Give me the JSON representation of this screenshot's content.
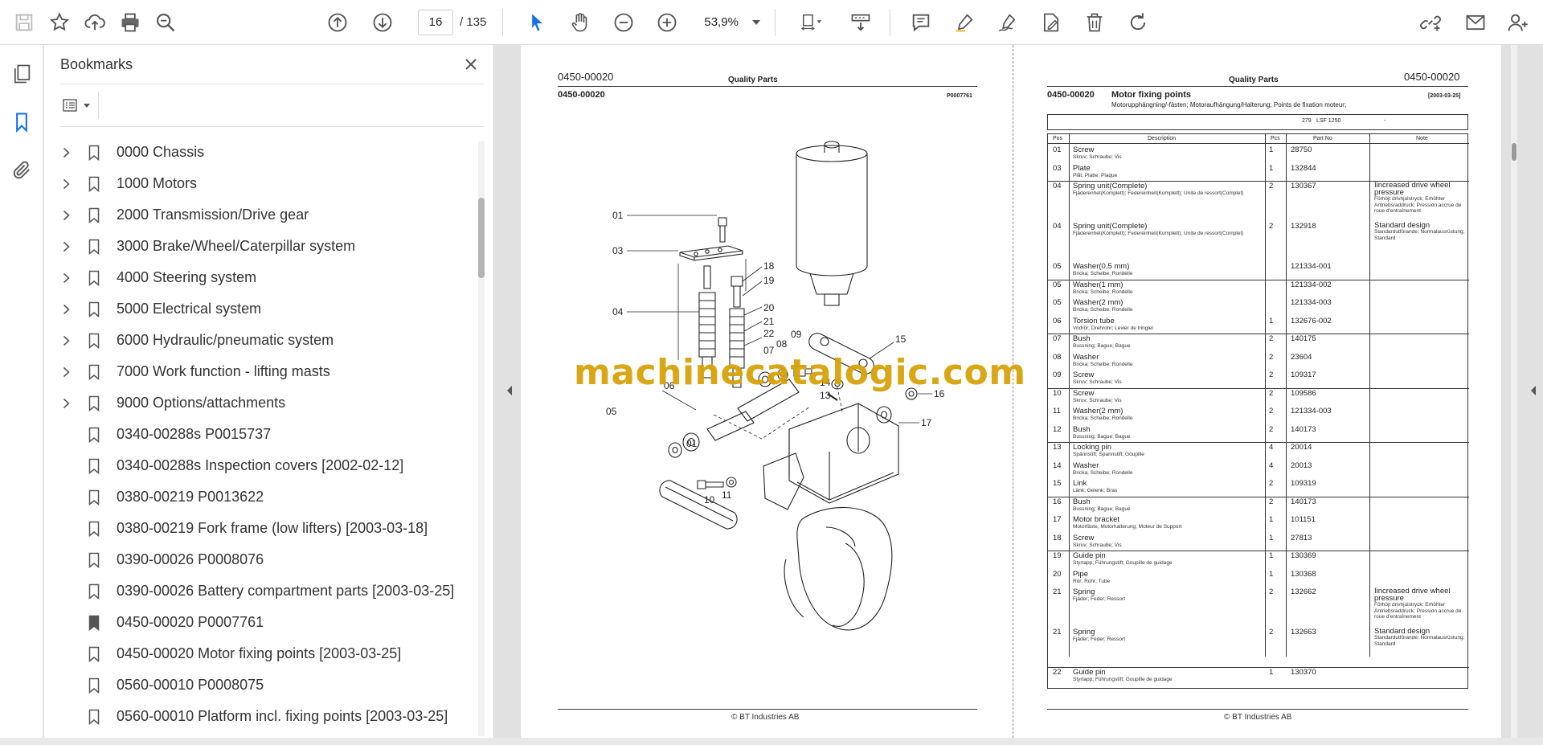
{
  "toolbar": {
    "current_page": "16",
    "page_total": "/ 135",
    "zoom": "53,9%"
  },
  "bookmarks": {
    "title": "Bookmarks",
    "items": [
      {
        "label": "0000 Chassis",
        "expandable": true
      },
      {
        "label": "1000 Motors",
        "expandable": true
      },
      {
        "label": "2000 Transmission/Drive gear",
        "expandable": true
      },
      {
        "label": "3000 Brake/Wheel/Caterpillar system",
        "expandable": true
      },
      {
        "label": "4000 Steering system",
        "expandable": true
      },
      {
        "label": "5000 Electrical system",
        "expandable": true
      },
      {
        "label": "6000 Hydraulic/pneumatic system",
        "expandable": true
      },
      {
        "label": "7000 Work function - lifting masts",
        "expandable": true
      },
      {
        "label": "9000 Options/attachments",
        "expandable": true
      },
      {
        "label": "0340-00288s P0015737",
        "expandable": false
      },
      {
        "label": "0340-00288s Inspection covers [2002-02-12]",
        "expandable": false
      },
      {
        "label": "0380-00219 P0013622",
        "expandable": false
      },
      {
        "label": "0380-00219 Fork frame (low lifters) [2003-03-18]",
        "expandable": false
      },
      {
        "label": "0390-00026 P0008076",
        "expandable": false
      },
      {
        "label": "0390-00026 Battery compartment parts [2003-03-25]",
        "expandable": false
      },
      {
        "label": "0450-00020 P0007761",
        "expandable": false,
        "active": true
      },
      {
        "label": "0450-00020 Motor fixing points [2003-03-25]",
        "expandable": false
      },
      {
        "label": "0560-00010 P0008075",
        "expandable": false
      },
      {
        "label": "0560-00010 Platform incl. fixing points [2003-03-25]",
        "expandable": false
      }
    ]
  },
  "left_page": {
    "code_top": "0450-00020",
    "header_center": "Quality Parts",
    "code_sub": "0450-00020",
    "ref": "P0007761",
    "footer": "© BT Industries AB",
    "callouts": [
      "01",
      "03",
      "04",
      "18",
      "19",
      "20",
      "21",
      "22",
      "07",
      "08",
      "09",
      "15",
      "06",
      "14",
      "13",
      "16",
      "05",
      "01",
      "17",
      "10",
      "11"
    ]
  },
  "watermark": "machinecatalogic.com",
  "right_page": {
    "header_center": "Quality Parts",
    "code_top": "0450-00020",
    "code_sub": "0450-00020",
    "title": "Motor fixing points",
    "date": "[2003-03-25]",
    "subtitle": "Motorupphängning/-fästen; Motoraufhängung/Halterung; Points de fixation moteur;",
    "model_num": "279",
    "model_name": "LSF 1250",
    "model_dash": "-",
    "columns": [
      "Pos",
      "Description",
      "Pcs",
      "Part No",
      "Note"
    ],
    "footer": "© BT Industries AB",
    "rows": [
      {
        "pos": "01",
        "desc": "Screw",
        "sub": "Skruv; Schraube; Vis",
        "pcs": "1",
        "part": "28750",
        "note": "",
        "note_sub": ""
      },
      {
        "pos": "03",
        "desc": "Plate",
        "sub": "Plåt; Platte; Plaque",
        "pcs": "1",
        "part": "132844",
        "note": "",
        "note_sub": ""
      },
      {
        "pos": "04",
        "desc": "Spring unit(Complete)",
        "sub": "Fjäderenhet(Komplett); Federeinheit(Komplett); Unite de ressort(Complet)",
        "pcs": "2",
        "part": "130367",
        "note": "Iincreased drive wheel pressure",
        "note_sub": "Förhöjt drivhjulstryck; Erhöhter Antriebsraddruck; Pression accrue de roue d'entraînement"
      },
      {
        "pos": "04",
        "desc": "Spring unit(Complete)",
        "sub": "Fjäderenhet(Komplett); Federeinheit(Komplett); Unite de ressort(Complet)",
        "pcs": "2",
        "part": "132918",
        "note": "Standard design",
        "note_sub": "Standardutförande; Normalausrüstung; Standard"
      },
      {
        "pos": "05",
        "desc": "Washer(0,5 mm)",
        "sub": "Bricka; Scheibe; Rondelle",
        "pcs": "",
        "part": "121334-001",
        "note": "",
        "note_sub": ""
      },
      {
        "pos": "05",
        "desc": "Washer(1 mm)",
        "sub": "Bricka; Scheibe; Rondelle",
        "pcs": "",
        "part": "121334-002",
        "note": "",
        "note_sub": ""
      },
      {
        "pos": "05",
        "desc": "Washer(2 mm)",
        "sub": "Bricka; Scheibe; Rondelle",
        "pcs": "",
        "part": "121334-003",
        "note": "",
        "note_sub": ""
      },
      {
        "pos": "06",
        "desc": "Torsion tube",
        "sub": "Vridrör; Drehrohr; Levier de tringlel",
        "pcs": "1",
        "part": "132676-002",
        "note": "",
        "note_sub": ""
      },
      {
        "pos": "07",
        "desc": "Bush",
        "sub": "Bussning; Bague; Bague",
        "pcs": "2",
        "part": "140175",
        "note": "",
        "note_sub": ""
      },
      {
        "pos": "08",
        "desc": "Washer",
        "sub": "Bricka; Scheibe; Rondelle",
        "pcs": "2",
        "part": "23604",
        "note": "",
        "note_sub": ""
      },
      {
        "pos": "09",
        "desc": "Screw",
        "sub": "Skruv; Schraube; Vis",
        "pcs": "2",
        "part": "109317",
        "note": "",
        "note_sub": ""
      },
      {
        "pos": "10",
        "desc": "Screw",
        "sub": "Skruv; Schraube; Vis",
        "pcs": "2",
        "part": "109586",
        "note": "",
        "note_sub": ""
      },
      {
        "pos": "11",
        "desc": "Washer(2 mm)",
        "sub": "Bricka; Scheibe; Rondelle",
        "pcs": "2",
        "part": "121334-003",
        "note": "",
        "note_sub": ""
      },
      {
        "pos": "12",
        "desc": "Bush",
        "sub": "Bussning; Bague; Bague",
        "pcs": "2",
        "part": "140173",
        "note": "",
        "note_sub": ""
      },
      {
        "pos": "13",
        "desc": "Locking pin",
        "sub": "Spännstift; Spannstift; Goupille",
        "pcs": "4",
        "part": "20014",
        "note": "",
        "note_sub": ""
      },
      {
        "pos": "14",
        "desc": "Washer",
        "sub": "Bricka; Scheibe; Rondelle",
        "pcs": "4",
        "part": "20013",
        "note": "",
        "note_sub": ""
      },
      {
        "pos": "15",
        "desc": "Link",
        "sub": "Länk; Gelenk; Bras",
        "pcs": "2",
        "part": "109319",
        "note": "",
        "note_sub": ""
      },
      {
        "pos": "16",
        "desc": "Bush",
        "sub": "Bussning; Bague; Bague",
        "pcs": "2",
        "part": "140173",
        "note": "",
        "note_sub": ""
      },
      {
        "pos": "17",
        "desc": "Motor bracket",
        "sub": "Motorfäste; Motorhalterung; Moteur de Support",
        "pcs": "1",
        "part": "101151",
        "note": "",
        "note_sub": ""
      },
      {
        "pos": "18",
        "desc": "Screw",
        "sub": "Skruv; Schraube; Vis",
        "pcs": "1",
        "part": "27813",
        "note": "",
        "note_sub": ""
      },
      {
        "pos": "19",
        "desc": "Guide pin",
        "sub": "Styrtapp; Führungstift; Goupille de guidage",
        "pcs": "1",
        "part": "130369",
        "note": "",
        "note_sub": ""
      },
      {
        "pos": "20",
        "desc": "Pipe",
        "sub": "Rör; Rohr; Tube",
        "pcs": "1",
        "part": "130368",
        "note": "",
        "note_sub": ""
      },
      {
        "pos": "21",
        "desc": "Spring",
        "sub": "Fjäder; Feder; Ressort",
        "pcs": "2",
        "part": "132662",
        "note": "Iincreased drive wheel pressure",
        "note_sub": "Förhöjt drivhjulstryck; Erhöhter Antriebsraddruck; Pression accrue de roue d'entraînement"
      },
      {
        "pos": "21",
        "desc": "Spring",
        "sub": "Fjäder; Feder; Ressort",
        "pcs": "2",
        "part": "132663",
        "note": "Standard design",
        "note_sub": "Standardutförande; Normalausrüstung; Standard"
      },
      {
        "pos": "22",
        "desc": "Guide pin",
        "sub": "Styrtapp; Führungstift; Goupille de guidage",
        "pcs": "1",
        "part": "130370",
        "note": "",
        "note_sub": ""
      }
    ]
  }
}
